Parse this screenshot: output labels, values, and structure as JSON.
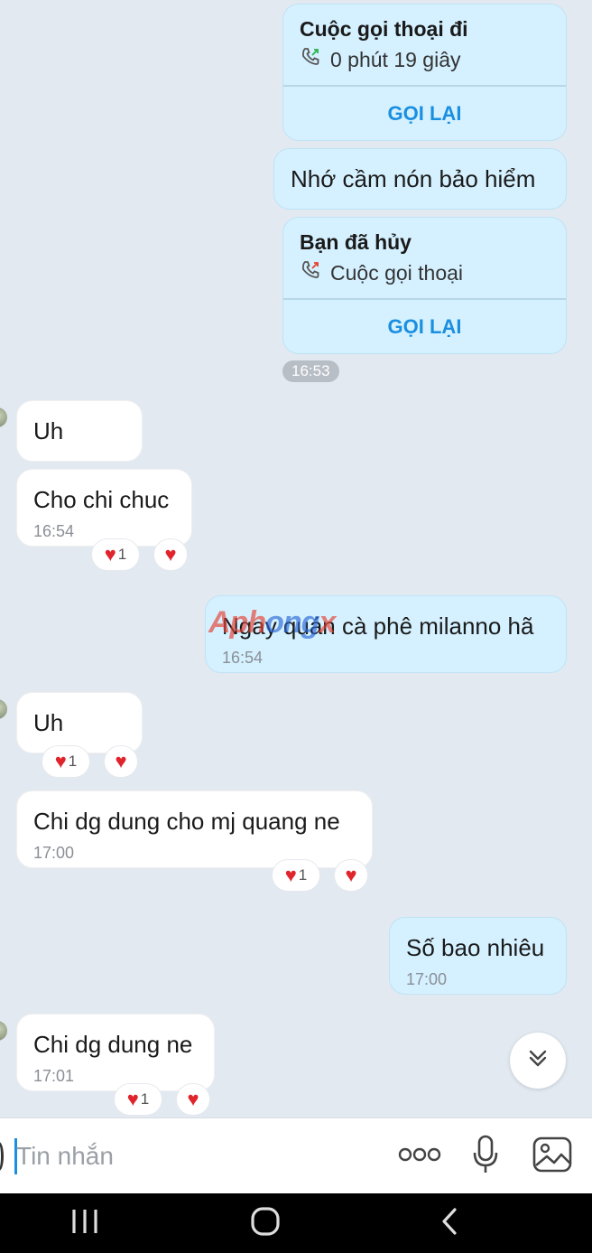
{
  "calls": [
    {
      "title": "Cuộc gọi thoại đi",
      "detail": "0 phút 19 giây",
      "action": "GỌI LẠI"
    },
    {
      "title": "Bạn đã hủy",
      "detail": "Cuộc gọi thoại",
      "action": "GỌI LẠI"
    }
  ],
  "messages": {
    "m1": {
      "text": "Nhớ cầm nón bảo hiểm"
    },
    "chip": {
      "time": "16:53"
    },
    "m2": {
      "text": "Uh"
    },
    "m3": {
      "text": "Cho chi chuc",
      "time": "16:54",
      "reaction_count": "1"
    },
    "m4": {
      "text": "Ngay quán cà phê milanno hã",
      "time": "16:54"
    },
    "m5": {
      "text": "Uh",
      "reaction_count": "1"
    },
    "m6": {
      "text": "Chi dg dung cho mj quang ne",
      "time": "17:00",
      "reaction_count": "1"
    },
    "m7": {
      "text": "Số bao nhiêu",
      "time": "17:00"
    },
    "m8": {
      "text": "Chi dg dung ne",
      "time": "17:01",
      "reaction_count": "1"
    }
  },
  "watermark": {
    "part1": "Aph",
    "part2": "ong",
    "part3": "x"
  },
  "composer": {
    "placeholder": "Tin nhắn"
  },
  "icons": {
    "call_out": "phone-outgoing-icon",
    "call_cancel": "phone-cancel-icon",
    "heart": "heart-icon",
    "scroll_down": "chevron-double-down-icon",
    "more": "more-dots-icon",
    "mic": "microphone-icon",
    "image": "image-icon"
  },
  "colors": {
    "accent": "#1a8fe0",
    "my_bubble": "#d5f1ff",
    "heart": "#e0242c",
    "background": "#e2e9f1"
  }
}
